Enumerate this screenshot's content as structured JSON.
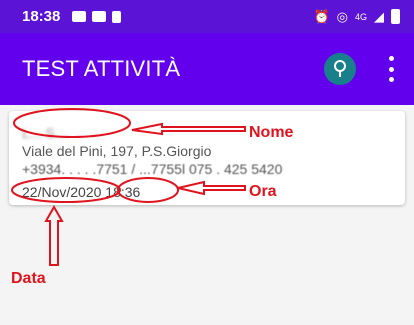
{
  "status_bar": {
    "time": "18:38",
    "left_icons": [
      "gallery-icon",
      "youtube-icon",
      "sim-icon"
    ],
    "right_icons": [
      "alarm-icon",
      "hotspot-icon",
      "signal-4g-icon",
      "battery-icon"
    ],
    "network": "4G"
  },
  "app_bar": {
    "title": "TEST ATTIVITÀ",
    "search_icon": "search-icon",
    "menu_icon": "more-vert-icon",
    "colors": {
      "status": "#5b14d6",
      "bar": "#6200ee",
      "search_bg": "#17808a"
    }
  },
  "entry": {
    "name": "L... S....",
    "address": "Viale del Pini, 197, P.S.Giorgio",
    "phones": "+3934. . . . .7751 / ...7755l 075 . 425 5420",
    "date": "22/Nov/2020",
    "time": "18:36"
  },
  "annotations": {
    "nome": "Nome",
    "ora": "Ora",
    "data": "Data",
    "color": "#e0141e"
  }
}
